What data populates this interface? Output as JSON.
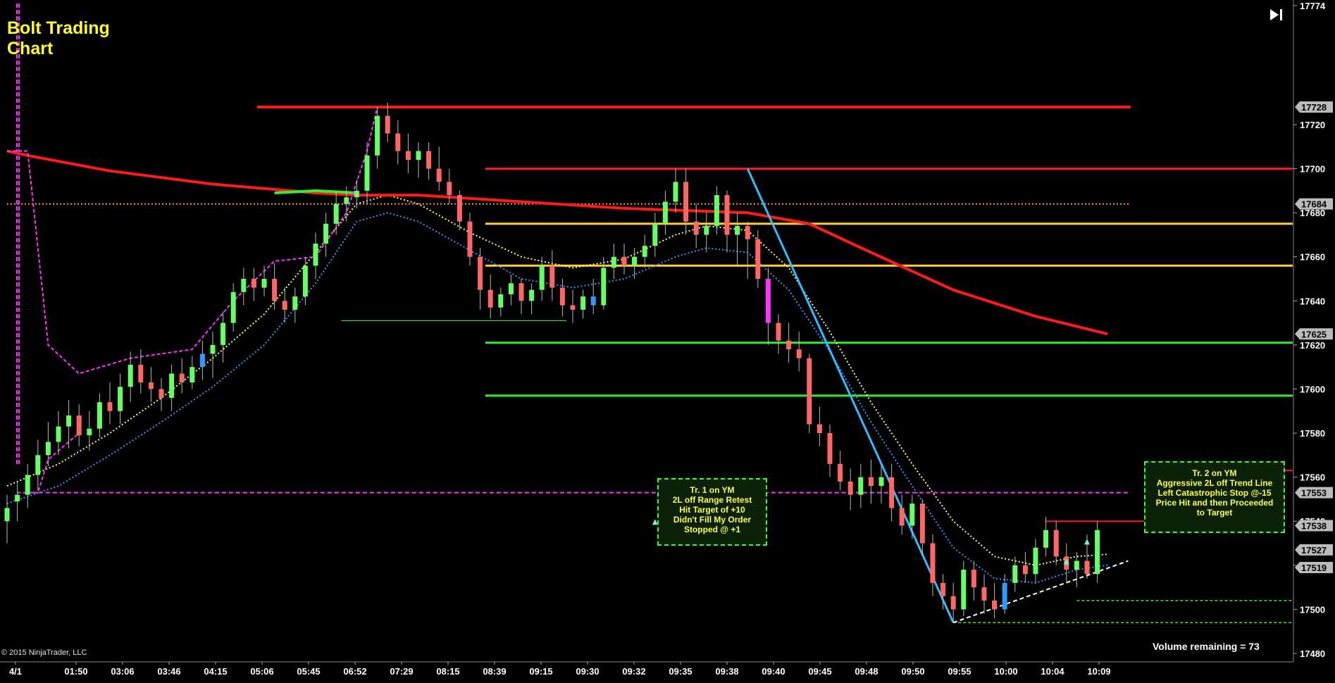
{
  "header": {
    "title_line1": "Bolt Trading",
    "title_line2": "Chart"
  },
  "footer": {
    "copyright": "© 2015 NinjaTrader, LLC",
    "volume": "Volume remaining = 73"
  },
  "notes": [
    {
      "lines": [
        "Tr. 1 on YM",
        "2L off Range Retest",
        "Hit Target of +10",
        "Didn't Fill My Order",
        "Stopped @ +1"
      ]
    },
    {
      "lines": [
        "Tr. 2 on YM",
        "Aggressive 2L off Trend Line",
        "Left Catastrophic Stop @-15",
        "Price Hit and then Proceeded",
        "to Target"
      ]
    }
  ],
  "colors": {
    "background": "#000000",
    "up_candle": "#66ff66",
    "down_candle": "#ff6666",
    "neutral_candle": "#3399ff",
    "highlight_candle": "#ff33ff",
    "sma_long": "#ff1a1a",
    "ema_fast": "#ffff66",
    "ema_slow": "#3399ff",
    "channel": "#ff33ff",
    "trendline": "#33bbff",
    "level_green": "#33ee33",
    "level_yellow": "#ffcc33",
    "level_red": "#ff1a1a",
    "axis_text": "#ffffff"
  },
  "chart_data": {
    "type": "candlestick",
    "title": "Bolt Trading Chart",
    "ylim": [
      17480,
      17774
    ],
    "y_ticks": [
      17480,
      17500,
      17520,
      17540,
      17560,
      17580,
      17600,
      17620,
      17640,
      17660,
      17680,
      17700,
      17720,
      17774
    ],
    "x_ticks": [
      "4/1",
      "01:50",
      "03:06",
      "03:46",
      "04:15",
      "05:06",
      "05:45",
      "06:52",
      "07:29",
      "08:15",
      "08:39",
      "09:15",
      "09:30",
      "09:32",
      "09:35",
      "09:38",
      "09:40",
      "09:45",
      "09:48",
      "09:50",
      "09:55",
      "10:00",
      "10:04",
      "10:09"
    ],
    "price_markers": [
      17728,
      17684,
      17625,
      17553,
      17538,
      17527,
      17519
    ],
    "levels": [
      {
        "name": "high",
        "value": 17728,
        "color": "red"
      },
      {
        "name": "red-level",
        "value": 17700,
        "color": "red"
      },
      {
        "name": "yellow-level-1",
        "value": 17675,
        "color": "yellow"
      },
      {
        "name": "yellow-level-2",
        "value": 17656,
        "color": "yellow"
      },
      {
        "name": "green-level-1",
        "value": 17621,
        "color": "green"
      },
      {
        "name": "green-level-2",
        "value": 17597,
        "color": "green"
      },
      {
        "name": "channel-low",
        "value": 17553,
        "color": "magenta-dashed"
      },
      {
        "name": "orange-dotted",
        "value": 17684,
        "color": "orange-dotted"
      }
    ],
    "candles": [
      [
        17540,
        17552,
        17530,
        17546
      ],
      [
        17549,
        17558,
        17540,
        17552
      ],
      [
        17552,
        17566,
        17546,
        17561
      ],
      [
        17561,
        17577,
        17554,
        17570
      ],
      [
        17570,
        17585,
        17565,
        17576
      ],
      [
        17576,
        17590,
        17570,
        17583
      ],
      [
        17583,
        17595,
        17573,
        17588
      ],
      [
        17588,
        17593,
        17574,
        17579
      ],
      [
        17579,
        17590,
        17572,
        17582
      ],
      [
        17582,
        17598,
        17578,
        17594
      ],
      [
        17594,
        17603,
        17584,
        17590
      ],
      [
        17590,
        17607,
        17584,
        17601
      ],
      [
        17601,
        17617,
        17594,
        17611
      ],
      [
        17611,
        17618,
        17598,
        17603
      ],
      [
        17603,
        17610,
        17594,
        17600
      ],
      [
        17600,
        17605,
        17590,
        17596
      ],
      [
        17596,
        17611,
        17590,
        17607
      ],
      [
        17607,
        17614,
        17598,
        17603
      ],
      [
        17603,
        17615,
        17600,
        17610
      ],
      [
        17610,
        17622,
        17604,
        17616
      ],
      [
        17616,
        17626,
        17605,
        17620
      ],
      [
        17620,
        17635,
        17612,
        17630
      ],
      [
        17630,
        17648,
        17626,
        17644
      ],
      [
        17644,
        17655,
        17638,
        17650
      ],
      [
        17650,
        17655,
        17640,
        17646
      ],
      [
        17646,
        17656,
        17642,
        17650
      ],
      [
        17650,
        17657,
        17636,
        17640
      ],
      [
        17640,
        17646,
        17630,
        17636
      ],
      [
        17636,
        17646,
        17630,
        17642
      ],
      [
        17642,
        17660,
        17638,
        17656
      ],
      [
        17656,
        17671,
        17650,
        17666
      ],
      [
        17666,
        17680,
        17660,
        17675
      ],
      [
        17675,
        17690,
        17670,
        17684
      ],
      [
        17684,
        17692,
        17676,
        17687
      ],
      [
        17687,
        17695,
        17682,
        17690
      ],
      [
        17690,
        17712,
        17684,
        17706
      ],
      [
        17706,
        17728,
        17700,
        17724
      ],
      [
        17724,
        17730,
        17712,
        17716
      ],
      [
        17716,
        17722,
        17702,
        17708
      ],
      [
        17708,
        17716,
        17698,
        17704
      ],
      [
        17704,
        17712,
        17696,
        17708
      ],
      [
        17708,
        17712,
        17695,
        17700
      ],
      [
        17700,
        17710,
        17690,
        17694
      ],
      [
        17694,
        17700,
        17684,
        17688
      ],
      [
        17688,
        17690,
        17672,
        17676
      ],
      [
        17676,
        17680,
        17656,
        17660
      ],
      [
        17660,
        17664,
        17636,
        17645
      ],
      [
        17645,
        17652,
        17632,
        17637
      ],
      [
        17637,
        17646,
        17633,
        17643
      ],
      [
        17643,
        17652,
        17638,
        17648
      ],
      [
        17648,
        17650,
        17634,
        17640
      ],
      [
        17640,
        17648,
        17634,
        17645
      ],
      [
        17645,
        17660,
        17640,
        17656
      ],
      [
        17656,
        17663,
        17640,
        17646
      ],
      [
        17646,
        17650,
        17633,
        17638
      ],
      [
        17638,
        17645,
        17630,
        17636
      ],
      [
        17636,
        17645,
        17632,
        17642
      ],
      [
        17642,
        17650,
        17634,
        17638
      ],
      [
        17638,
        17660,
        17636,
        17655
      ],
      [
        17655,
        17666,
        17650,
        17660
      ],
      [
        17660,
        17666,
        17652,
        17656
      ],
      [
        17656,
        17664,
        17650,
        17660
      ],
      [
        17660,
        17670,
        17655,
        17665
      ],
      [
        17665,
        17680,
        17660,
        17675
      ],
      [
        17675,
        17690,
        17670,
        17685
      ],
      [
        17685,
        17700,
        17680,
        17694
      ],
      [
        17694,
        17700,
        17670,
        17676
      ],
      [
        17676,
        17684,
        17664,
        17670
      ],
      [
        17670,
        17680,
        17662,
        17674
      ],
      [
        17674,
        17692,
        17670,
        17688
      ],
      [
        17688,
        17690,
        17662,
        17670
      ],
      [
        17670,
        17680,
        17656,
        17674
      ],
      [
        17674,
        17676,
        17650,
        17668
      ],
      [
        17668,
        17672,
        17646,
        17650
      ],
      [
        17650,
        17655,
        17620,
        17630
      ],
      [
        17630,
        17634,
        17616,
        17622
      ],
      [
        17622,
        17630,
        17612,
        17618
      ],
      [
        17618,
        17626,
        17608,
        17614
      ],
      [
        17614,
        17616,
        17580,
        17584
      ],
      [
        17584,
        17592,
        17574,
        17580
      ],
      [
        17580,
        17584,
        17560,
        17566
      ],
      [
        17566,
        17572,
        17554,
        17558
      ],
      [
        17558,
        17564,
        17545,
        17552
      ],
      [
        17552,
        17566,
        17546,
        17560
      ],
      [
        17560,
        17568,
        17548,
        17556
      ],
      [
        17556,
        17566,
        17548,
        17560
      ],
      [
        17560,
        17566,
        17540,
        17546
      ],
      [
        17546,
        17552,
        17534,
        17538
      ],
      [
        17538,
        17552,
        17532,
        17548
      ],
      [
        17548,
        17550,
        17524,
        17530
      ],
      [
        17530,
        17534,
        17506,
        17512
      ],
      [
        17512,
        17516,
        17500,
        17506
      ],
      [
        17506,
        17512,
        17494,
        17500
      ],
      [
        17500,
        17522,
        17497,
        17518
      ],
      [
        17518,
        17522,
        17504,
        17510
      ],
      [
        17510,
        17516,
        17498,
        17504
      ],
      [
        17504,
        17512,
        17496,
        17500
      ],
      [
        17500,
        17516,
        17498,
        17512
      ],
      [
        17512,
        17524,
        17508,
        17520
      ],
      [
        17520,
        17526,
        17512,
        17516
      ],
      [
        17516,
        17532,
        17512,
        17528
      ],
      [
        17528,
        17542,
        17524,
        17536
      ],
      [
        17536,
        17540,
        17520,
        17524
      ],
      [
        17524,
        17530,
        17512,
        17518
      ],
      [
        17518,
        17526,
        17510,
        17522
      ],
      [
        17522,
        17534,
        17514,
        17516
      ],
      [
        17516,
        17540,
        17512,
        17536
      ]
    ],
    "sma_long": [
      [
        0,
        17708
      ],
      [
        2,
        17706
      ],
      [
        10,
        17699
      ],
      [
        20,
        17693
      ],
      [
        30,
        17689
      ],
      [
        34,
        17688
      ],
      [
        40,
        17688
      ],
      [
        50,
        17685
      ],
      [
        60,
        17682
      ],
      [
        66,
        17681
      ],
      [
        72,
        17680
      ],
      [
        78,
        17675
      ],
      [
        84,
        17662
      ],
      [
        92,
        17645
      ],
      [
        100,
        17633
      ],
      [
        107,
        17625
      ]
    ],
    "ema_fast": [
      [
        0,
        17556
      ],
      [
        5,
        17566
      ],
      [
        10,
        17580
      ],
      [
        15,
        17596
      ],
      [
        20,
        17614
      ],
      [
        25,
        17634
      ],
      [
        30,
        17662
      ],
      [
        34,
        17684
      ],
      [
        37,
        17688
      ],
      [
        40,
        17684
      ],
      [
        45,
        17671
      ],
      [
        50,
        17660
      ],
      [
        55,
        17655
      ],
      [
        60,
        17659
      ],
      [
        65,
        17670
      ],
      [
        68,
        17674
      ],
      [
        72,
        17672
      ],
      [
        76,
        17655
      ],
      [
        80,
        17626
      ],
      [
        84,
        17594
      ],
      [
        88,
        17566
      ],
      [
        92,
        17540
      ],
      [
        96,
        17524
      ],
      [
        100,
        17520
      ],
      [
        104,
        17524
      ],
      [
        107,
        17525
      ]
    ],
    "ema_slow": [
      [
        0,
        17548
      ],
      [
        5,
        17556
      ],
      [
        10,
        17570
      ],
      [
        15,
        17585
      ],
      [
        20,
        17601
      ],
      [
        25,
        17620
      ],
      [
        30,
        17648
      ],
      [
        34,
        17676
      ],
      [
        37,
        17680
      ],
      [
        40,
        17676
      ],
      [
        45,
        17663
      ],
      [
        50,
        17650
      ],
      [
        55,
        17646
      ],
      [
        60,
        17650
      ],
      [
        65,
        17660
      ],
      [
        68,
        17664
      ],
      [
        72,
        17662
      ],
      [
        76,
        17645
      ],
      [
        80,
        17617
      ],
      [
        84,
        17585
      ],
      [
        88,
        17556
      ],
      [
        92,
        17528
      ],
      [
        96,
        17514
      ],
      [
        100,
        17512
      ],
      [
        104,
        17518
      ],
      [
        107,
        17520
      ]
    ],
    "channel_upper": [
      [
        0,
        17708
      ],
      [
        2,
        17708
      ],
      [
        4,
        17620
      ],
      [
        7,
        17607
      ],
      [
        12,
        17614
      ],
      [
        18,
        17618
      ],
      [
        22,
        17640
      ],
      [
        26,
        17658
      ],
      [
        30,
        17660
      ],
      [
        33,
        17680
      ],
      [
        35,
        17708
      ],
      [
        36,
        17728
      ]
    ],
    "channel_lower": [
      [
        1,
        17553
      ],
      [
        3,
        17553
      ],
      [
        4,
        17568
      ],
      [
        7,
        17580
      ]
    ],
    "trendline": [
      [
        72,
        17700
      ],
      [
        92,
        17494
      ]
    ],
    "support_line": [
      [
        92,
        17494
      ],
      [
        109,
        17522
      ]
    ]
  }
}
